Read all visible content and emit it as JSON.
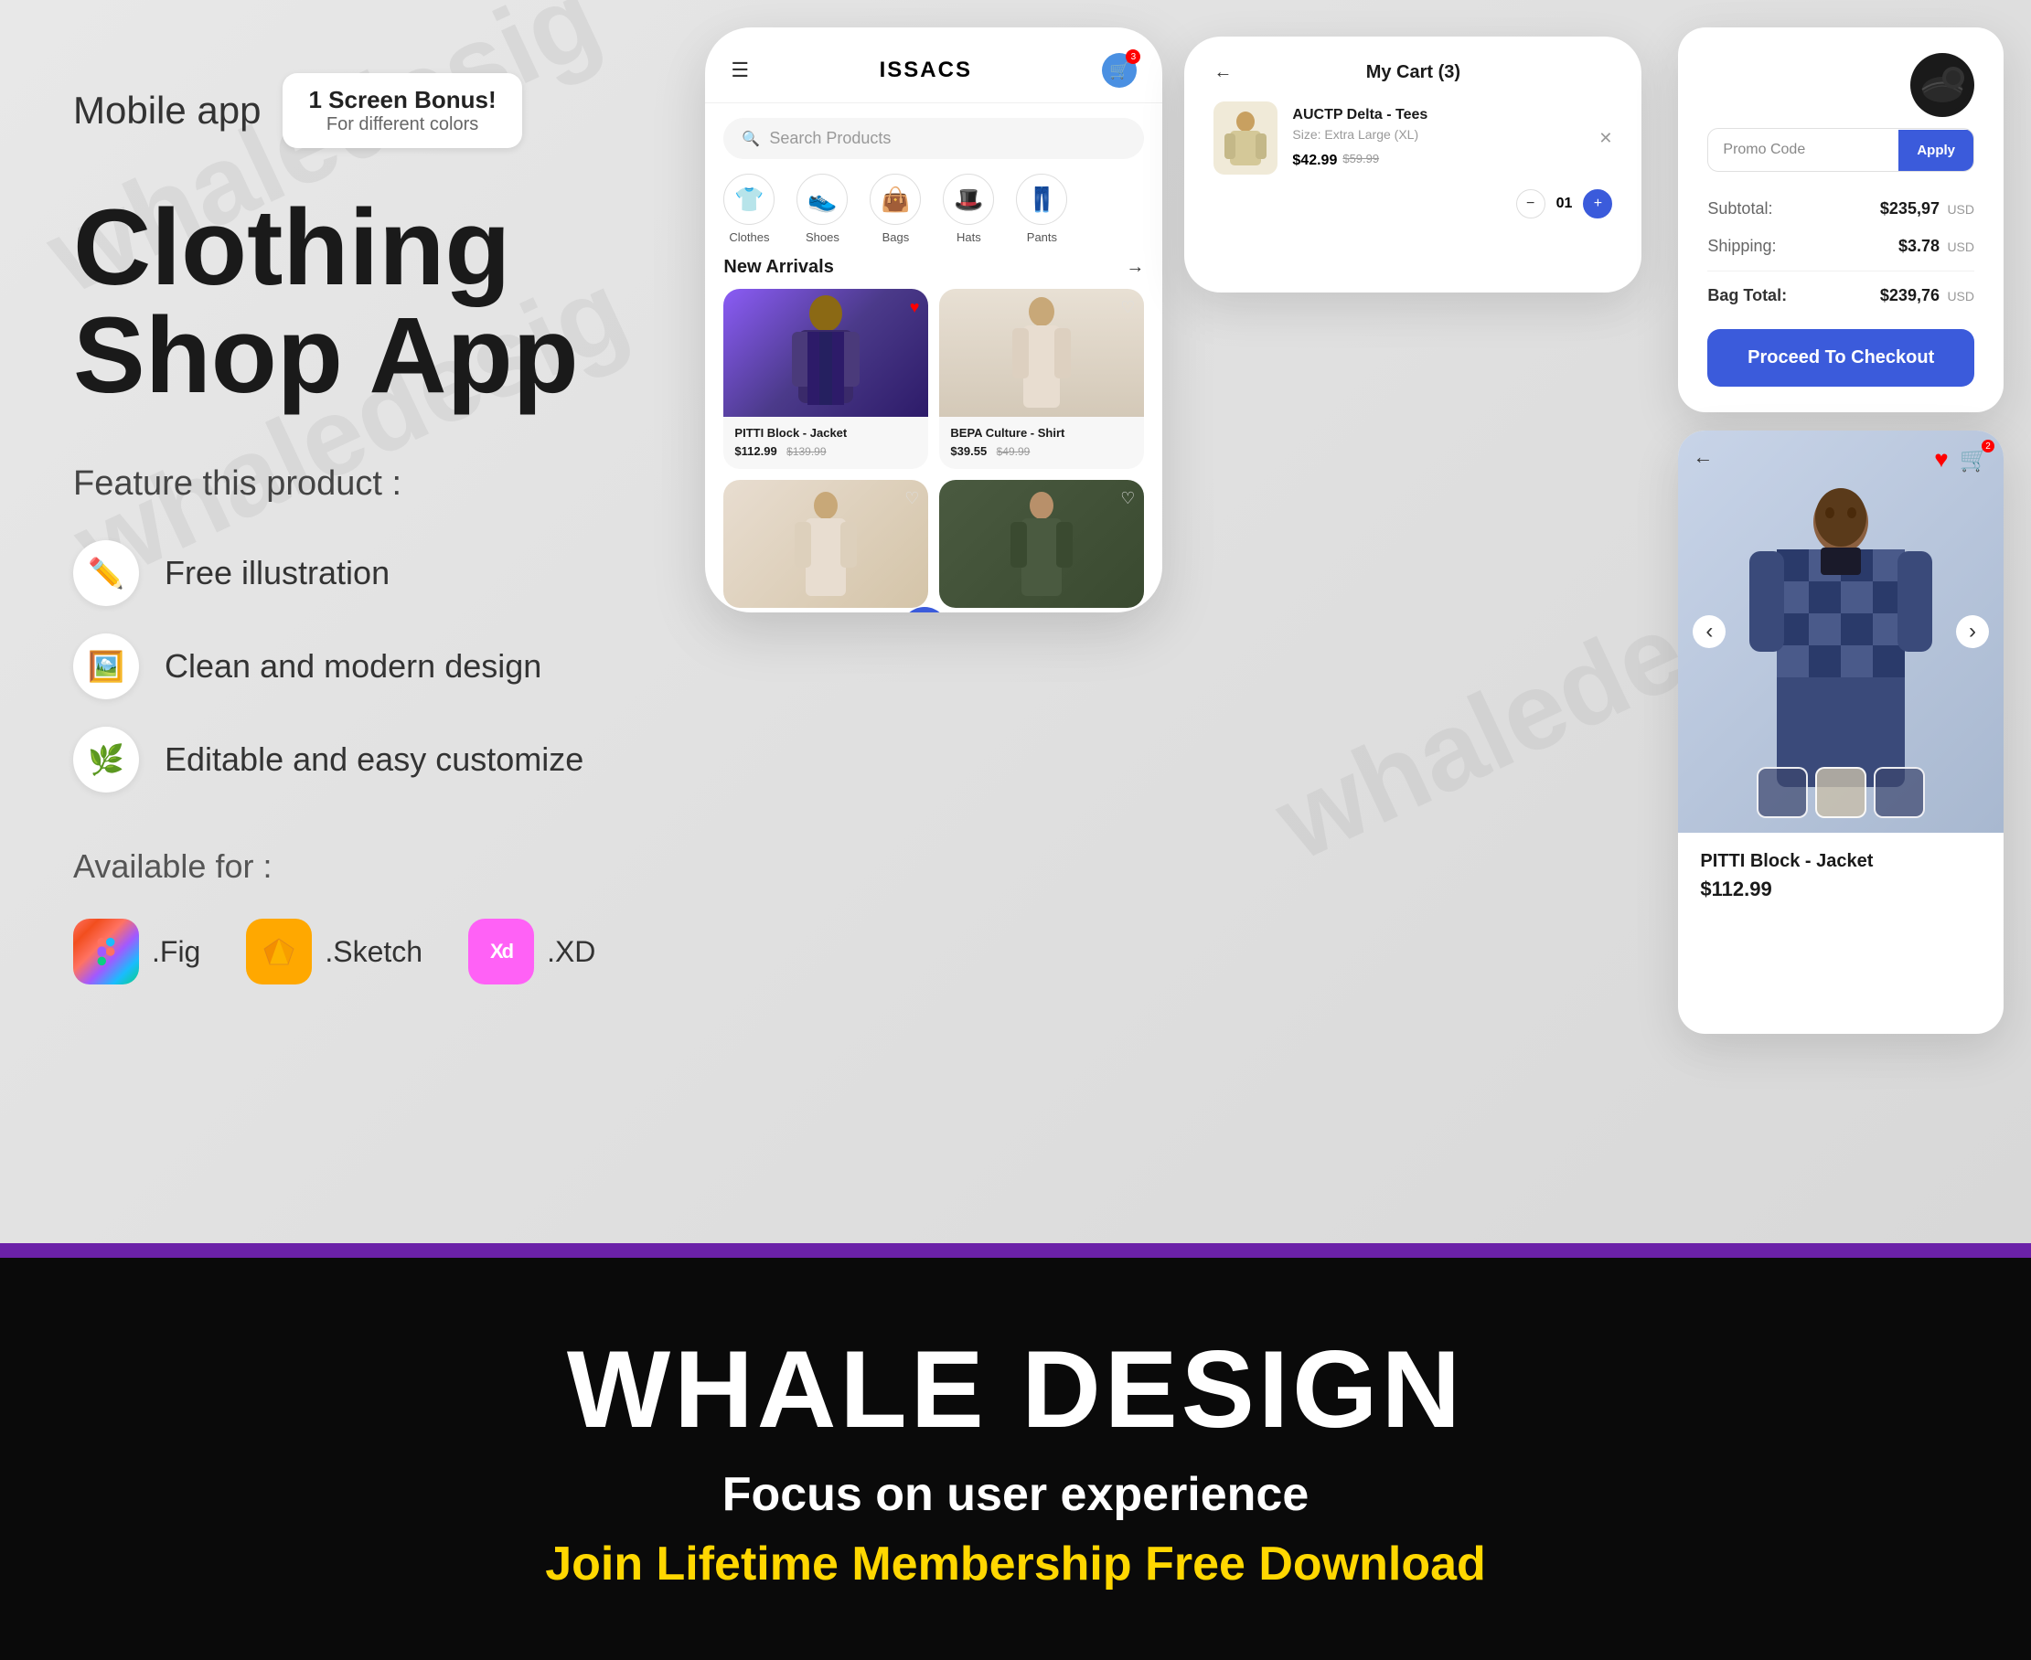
{
  "top_section": {
    "watermarks": [
      "whaledesig",
      "whaledesig",
      "whaledesig"
    ]
  },
  "left_panel": {
    "mobile_app_label": "Mobile app",
    "bonus_badge": {
      "title": "1 Screen Bonus!",
      "subtitle": "For different colors"
    },
    "main_title": "Clothing Shop App",
    "feature_section_title": "Feature this product :",
    "features": [
      {
        "icon": "✏️",
        "text": "Free illustration"
      },
      {
        "icon": "🖼️",
        "text": "Clean and modern design"
      },
      {
        "icon": "🌿",
        "text": "Editable and easy customize"
      }
    ],
    "available_title": "Available for :",
    "platforms": [
      {
        "name": "figma",
        "icon": "❖",
        "label": ".Fig"
      },
      {
        "name": "sketch",
        "icon": "◇",
        "label": ".Sketch"
      },
      {
        "name": "xd",
        "icon": "Xd",
        "label": ".XD"
      }
    ]
  },
  "phone_screen": {
    "store_name": "ISSACS",
    "search_placeholder": "Search Products",
    "categories": [
      {
        "icon": "👕",
        "label": "Clothes"
      },
      {
        "icon": "👟",
        "label": "Shoes"
      },
      {
        "icon": "👜",
        "label": "Bags"
      },
      {
        "icon": "🎩",
        "label": "Hats"
      },
      {
        "icon": "👖",
        "label": "Pants"
      }
    ],
    "new_arrivals_title": "New Arrivals",
    "products": [
      {
        "name": "PITTI Block - Jacket",
        "price": "$112.99",
        "original_price": "$139.99"
      },
      {
        "name": "BEPA Culture - Shirt",
        "price": "$39.55",
        "original_price": "$49.99"
      }
    ]
  },
  "cart_screen": {
    "title": "My Cart (3)",
    "item": {
      "name": "AUCTP Delta - Tees",
      "size": "Size: Extra Large (XL)",
      "price": "$42.99",
      "original_price": "$59.99",
      "quantity": "01"
    }
  },
  "checkout_card": {
    "promo_placeholder": "Promo Code",
    "apply_label": "Apply",
    "subtotal_label": "Subtotal:",
    "subtotal_value": "$235,97",
    "subtotal_currency": "USD",
    "shipping_label": "Shipping:",
    "shipping_value": "$3.78",
    "shipping_currency": "USD",
    "bag_total_label": "Bag Total:",
    "bag_total_value": "$239,76",
    "bag_total_currency": "USD",
    "checkout_button_label": "Proceed To Checkout"
  },
  "product_detail": {
    "product_name": "PITTI Block - Jacket",
    "product_price": "$112.99"
  },
  "bottom_banner": {
    "brand_name": "WHALE DESIGN",
    "tagline": "Focus on user experience",
    "cta": "Join Lifetime Membership Free Download"
  }
}
